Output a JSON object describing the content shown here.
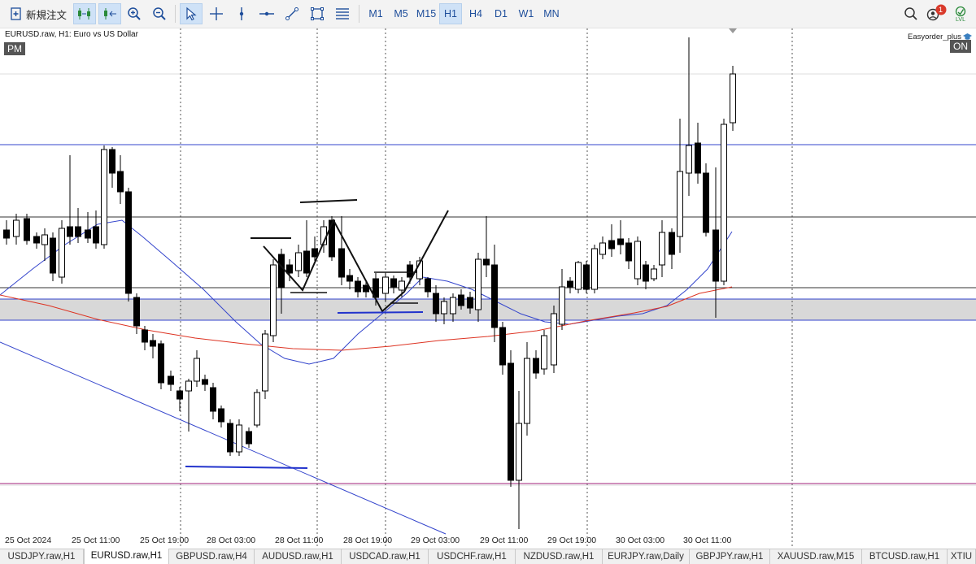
{
  "toolbar": {
    "new_order_label": "新規注文",
    "timeframes": [
      "M1",
      "M5",
      "M15",
      "H1",
      "H4",
      "D1",
      "W1",
      "MN"
    ],
    "active_timeframe": "H1",
    "notification_count": "1",
    "lvl_label": "LVL"
  },
  "chart": {
    "title": "EURUSD.raw, H1:  Euro vs US Dollar",
    "pm_badge": "PM",
    "ea_label": "Easyorder_plus",
    "on_badge": "ON"
  },
  "chart_data": {
    "type": "candlestick",
    "time_labels": [
      "25 Oct 2024",
      "25 Oct 11:00",
      "25 Oct 19:00",
      "28 Oct 03:00",
      "28 Oct 11:00",
      "28 Oct 19:00",
      "29 Oct 03:00",
      "29 Oct 11:00",
      "29 Oct 19:00",
      "30 Oct 03:00",
      "30 Oct 11:00"
    ],
    "grid": true,
    "bull_color": "#ffffff",
    "bear_color": "#000000",
    "ma_fast_color": "#3344cc",
    "ma_slow_color": "#dd3322",
    "zone_color": "#d8d8d8",
    "line_color_blue": "#3344cc",
    "line_color_dark": "#333333",
    "line_color_magenta": "#a0207a"
  },
  "tabs": [
    {
      "label": "USDJPY.raw,H1"
    },
    {
      "label": "EURUSD.raw,H1"
    },
    {
      "label": "GBPUSD.raw,H4"
    },
    {
      "label": "AUDUSD.raw,H1"
    },
    {
      "label": "USDCAD.raw,H1"
    },
    {
      "label": "USDCHF.raw,H1"
    },
    {
      "label": "NZDUSD.raw,H1"
    },
    {
      "label": "EURJPY.raw,Daily"
    },
    {
      "label": "GBPJPY.raw,H1"
    },
    {
      "label": "XAUUSD.raw,M15"
    },
    {
      "label": "BTCUSD.raw,H1"
    },
    {
      "label": "XTIU"
    }
  ],
  "active_tab": "EURUSD.raw,H1"
}
